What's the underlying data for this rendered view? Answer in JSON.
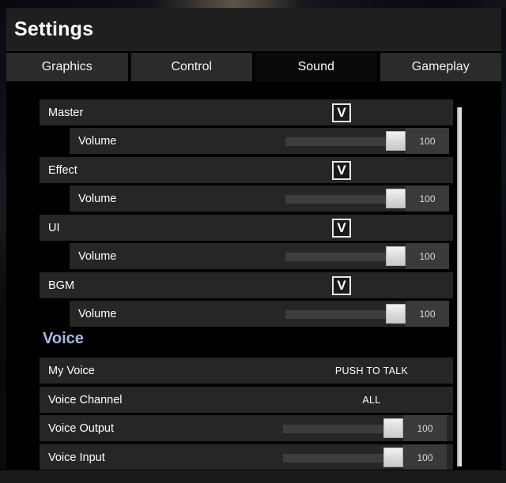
{
  "window": {
    "title": "Settings"
  },
  "tabs": [
    {
      "label": "Graphics",
      "active": false
    },
    {
      "label": "Control",
      "active": false
    },
    {
      "label": "Sound",
      "active": true
    },
    {
      "label": "Gameplay",
      "active": false
    }
  ],
  "colors": {
    "accent_section": "#a4bbe4",
    "row_bg": "#262626",
    "panel_bg": "#000000",
    "titlebar_bg": "#1f1f1f",
    "tab_bg": "#2b2b2b",
    "tab_active_bg": "#0a0a0a",
    "slider_track": "#3d3d3d",
    "slider_handle": "#dcdcdc",
    "value_box_bg": "#3a3a3a"
  },
  "sound": {
    "groups": [
      {
        "name": "Master",
        "checkbox_label": "Master",
        "checked": true,
        "check_glyph": "V",
        "volume_label": "Volume",
        "volume_value": "100",
        "volume_percent": 100
      },
      {
        "name": "Effect",
        "checkbox_label": "Effect",
        "checked": true,
        "check_glyph": "V",
        "volume_label": "Volume",
        "volume_value": "100",
        "volume_percent": 100
      },
      {
        "name": "UI",
        "checkbox_label": "UI",
        "checked": true,
        "check_glyph": "V",
        "volume_label": "Volume",
        "volume_value": "100",
        "volume_percent": 100
      },
      {
        "name": "BGM",
        "checkbox_label": "BGM",
        "checked": true,
        "check_glyph": "V",
        "volume_label": "Volume",
        "volume_value": "100",
        "volume_percent": 100
      }
    ]
  },
  "voice": {
    "section_title": "Voice",
    "rows": [
      {
        "label": "My Voice",
        "type": "option",
        "value": "PUSH TO TALK"
      },
      {
        "label": "Voice Channel",
        "type": "option",
        "value": "ALL"
      },
      {
        "label": "Voice Output",
        "type": "slider",
        "value": "100",
        "percent": 100
      },
      {
        "label": "Voice Input",
        "type": "slider",
        "value": "100",
        "percent": 100
      }
    ]
  },
  "scrollbar": {
    "orientation": "vertical",
    "thumb_position_percent": 6
  }
}
